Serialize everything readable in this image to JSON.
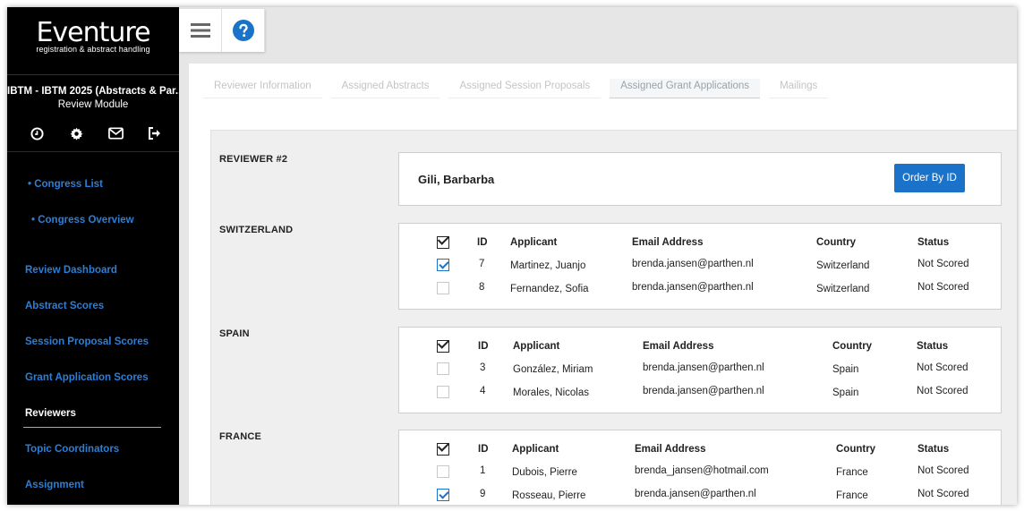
{
  "app": {
    "logo_title": "Eventure",
    "logo_subtitle": "registration & abstract handling"
  },
  "sidebar": {
    "congress": "IBTM - IBTM 2025 (Abstracts & Par...",
    "module": "Review Module",
    "icons": [
      "clock-icon",
      "gear-icon",
      "mail-icon",
      "logout-icon"
    ],
    "links": [
      {
        "label": "• Congress List"
      },
      {
        "label": "• Congress Overview"
      },
      {
        "label": "Review Dashboard"
      },
      {
        "label": "Abstract Scores"
      },
      {
        "label": "Session Proposal Scores"
      },
      {
        "label": "Grant Application Scores"
      },
      {
        "label": "Reviewers"
      },
      {
        "label": "Topic Coordinators"
      },
      {
        "label": "Assignment"
      }
    ]
  },
  "tabs": [
    {
      "label": "Reviewer Information"
    },
    {
      "label": "Assigned Abstracts"
    },
    {
      "label": "Assigned Session Proposals"
    },
    {
      "label": "Assigned Grant Applications"
    },
    {
      "label": "Mailings"
    }
  ],
  "reviewer": {
    "label": "REVIEWER #2",
    "name": "Gili, Barbarba",
    "order_button": "Order By ID"
  },
  "table_headers": {
    "id": "ID",
    "applicant": "Applicant",
    "email": "Email Address",
    "country": "Country",
    "status": "Status"
  },
  "groups": [
    {
      "label": "SWITZERLAND",
      "rows": [
        {
          "checked": true,
          "id": "7",
          "applicant": "Martinez, Juanjo",
          "email": "brenda.jansen@parthen.nl",
          "country": "Switzerland",
          "status": "Not Scored"
        },
        {
          "checked": false,
          "id": "8",
          "applicant": "Fernandez, Sofia",
          "email": "brenda.jansen@parthen.nl",
          "country": "Switzerland",
          "status": "Not Scored"
        }
      ]
    },
    {
      "label": "SPAIN",
      "rows": [
        {
          "checked": false,
          "id": "3",
          "applicant": "González, Miriam",
          "email": "brenda.jansen@parthen.nl",
          "country": "Spain",
          "status": "Not Scored"
        },
        {
          "checked": false,
          "id": "4",
          "applicant": "Morales, Nicolas",
          "email": "brenda.jansen@parthen.nl",
          "country": "Spain",
          "status": "Not Scored"
        }
      ]
    },
    {
      "label": "FRANCE",
      "rows": [
        {
          "checked": false,
          "id": "1",
          "applicant": "Dubois, Pierre",
          "email": "brenda_jansen@hotmail.com",
          "country": "France",
          "status": "Not Scored"
        },
        {
          "checked": true,
          "id": "9",
          "applicant": "Rosseau, Pierre",
          "email": "brenda.jansen@parthen.nl",
          "country": "France",
          "status": "Not Scored"
        }
      ]
    }
  ],
  "colors": {
    "accent": "#1a73c8",
    "sidebar_link": "#2d7fd6",
    "sidebar_bg": "#000000"
  }
}
